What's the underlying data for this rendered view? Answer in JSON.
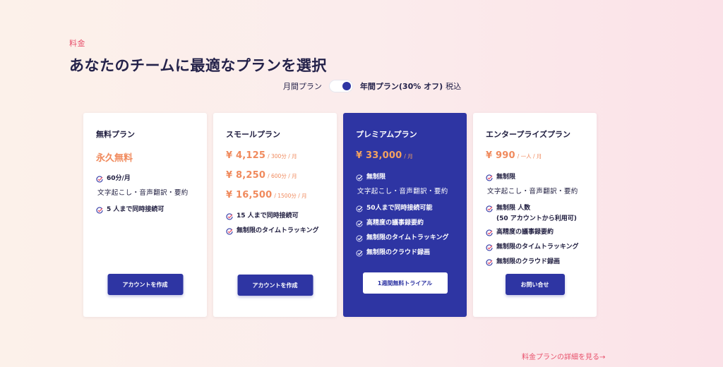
{
  "eyebrow": "料金",
  "title": "あなたのチームに最適なプランを選択",
  "billing": {
    "monthly": "月間プラン",
    "yearly": "年間プラン(30% オフ)",
    "tax": "税込"
  },
  "colors": {
    "accent": "#2e35a3",
    "price": "#f08a5d",
    "link": "#e8506b"
  },
  "plans": [
    {
      "name": "無料プラン",
      "price_label": "永久無料",
      "features": [
        {
          "text": "60分/月",
          "sub": "文字起こし・音声翻訳・要約"
        },
        {
          "text": "5 人まで同時接続可"
        }
      ],
      "button": "アカウントを作成"
    },
    {
      "name": "スモールプラン",
      "prices": [
        {
          "amount": "¥ 4,125",
          "unit": "/ 300分 / 月"
        },
        {
          "amount": "¥ 8,250",
          "unit": "/ 600分 / 月"
        },
        {
          "amount": "¥ 16,500",
          "unit": "/ 1500分 / 月"
        }
      ],
      "features": [
        {
          "text": "15 人まで同時接続可"
        },
        {
          "text": "無制限のタイムトラッキング"
        }
      ],
      "button": "アカウントを作成"
    },
    {
      "name": "プレミアムプラン",
      "prices": [
        {
          "amount": "¥ 33,000",
          "unit": "/ 月"
        }
      ],
      "features": [
        {
          "text": "無制限",
          "sub": "文字起こし・音声翻訳・要約"
        },
        {
          "text": "50人まで同時接続可能"
        },
        {
          "text": "高精度の議事録要約"
        },
        {
          "text": "無制限のタイムトラッキング"
        },
        {
          "text": "無制限のクラウド録画"
        }
      ],
      "button": "1週間無料トライアル"
    },
    {
      "name": "エンタープライズプラン",
      "prices": [
        {
          "amount": "¥ 990",
          "unit": "/ 一人 / 月"
        }
      ],
      "features": [
        {
          "text": "無制限",
          "sub": "文字起こし・音声翻訳・要約"
        },
        {
          "text": "無制限 人数",
          "sub2": "(50 アカウントから利用可)"
        },
        {
          "text": "高精度の議事録要約"
        },
        {
          "text": "無制限のタイムトラッキング"
        },
        {
          "text": "無制限のクラウド録画"
        }
      ],
      "button": "お問い合せ"
    }
  ],
  "more_link": "料金プランの詳細を見る→"
}
